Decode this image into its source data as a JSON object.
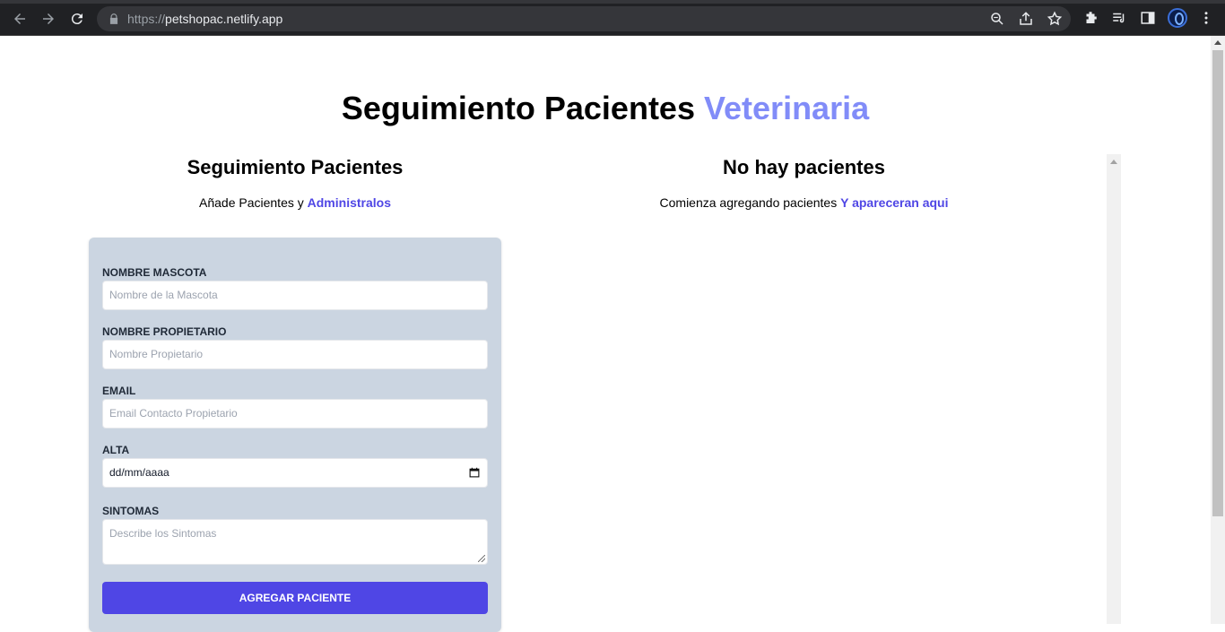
{
  "browser": {
    "url_scheme": "https://",
    "url_host": "petshopac.netlify.app",
    "icons": [
      "back-icon",
      "forward-icon",
      "reload-icon",
      "lock-icon",
      "zoom-icon",
      "share-icon",
      "star-icon",
      "extensions-icon",
      "media-icon",
      "sidepanel-icon",
      "profile-avatar",
      "kebab-menu-icon"
    ]
  },
  "header": {
    "title_main": "Seguimiento Pacientes",
    "title_accent": "Veterinaria",
    "accent_color": "#818cf8"
  },
  "form_section": {
    "title": "Seguimiento Pacientes",
    "subtitle_prefix": "Añade Pacientes y",
    "subtitle_highlight": "Administralos"
  },
  "form": {
    "fields": [
      {
        "label": "NOMBRE MASCOTA",
        "placeholder": "Nombre de la Mascota"
      },
      {
        "label": "NOMBRE PROPIETARIO",
        "placeholder": "Nombre Propietario"
      },
      {
        "label": "EMAIL",
        "placeholder": "Email Contacto Propietario"
      },
      {
        "label": "ALTA",
        "value": "dd/mm/aaaa"
      },
      {
        "label": "SINTOMAS",
        "placeholder": "Describe los Sintomas"
      }
    ],
    "submit_label": "AGREGAR PACIENTE",
    "button_color": "#4f46e5",
    "card_color": "#cbd5e1"
  },
  "list_section": {
    "title": "No hay pacientes",
    "subtitle_prefix": "Comienza agregando pacientes",
    "subtitle_highlight": "Y apareceran aqui"
  }
}
